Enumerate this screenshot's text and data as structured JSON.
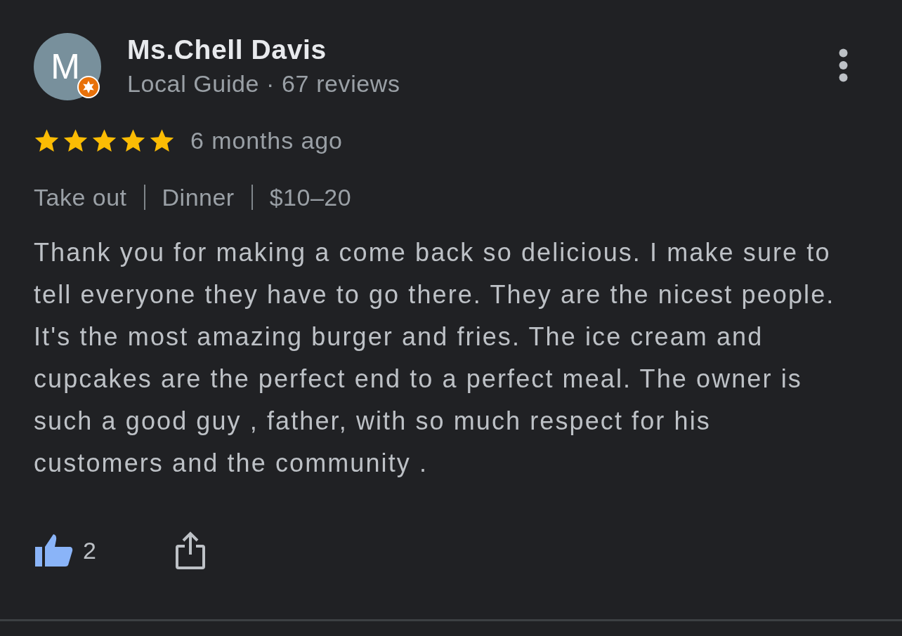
{
  "review": {
    "author": {
      "avatar_letter": "M",
      "local_guide_badge": true,
      "name": "Ms.Chell Davis",
      "subtitle": "Local Guide · 67 reviews"
    },
    "stars": 5,
    "time": "6 months ago",
    "tags": [
      "Take out",
      "Dinner",
      "$10–20"
    ],
    "text": "Thank you for making a come back so delicious. I make sure to tell everyone they have to go there. They are the nicest people. It's the most amazing burger and fries. The ice cream and cupcakes are the perfect end to a perfect meal. The owner is such a good guy , father, with so much respect for his customers and the community .",
    "likes": {
      "liked": true,
      "count": "2"
    }
  }
}
